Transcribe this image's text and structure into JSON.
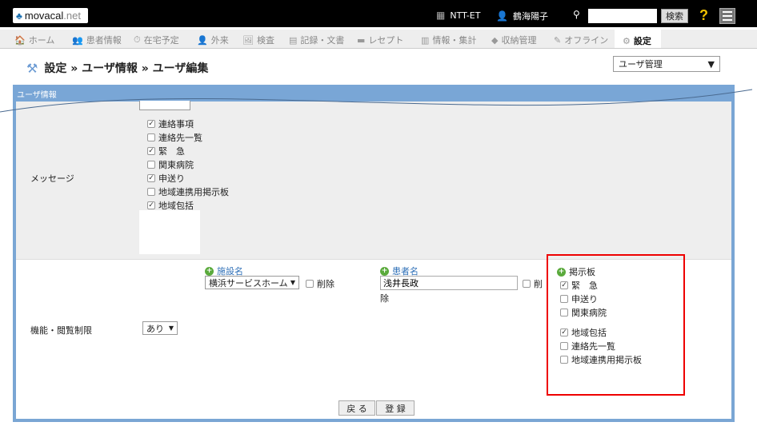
{
  "header": {
    "logo_mark": "♣",
    "logo_main": "movacal",
    "logo_net": ".net",
    "facility": "NTT-ET",
    "user": "鶴海陽子",
    "search_placeholder": "",
    "search_button": "検索",
    "help": "?"
  },
  "nav": [
    {
      "label": "ホーム",
      "icon": "🏠"
    },
    {
      "label": "患者情報",
      "icon": "👥"
    },
    {
      "label": "在宅予定",
      "icon": "⏱"
    },
    {
      "label": "外来",
      "icon": "👤"
    },
    {
      "label": "検査",
      "icon": "🖼"
    },
    {
      "label": "記録・文書",
      "icon": "▤"
    },
    {
      "label": "レセプト",
      "icon": "▬"
    },
    {
      "label": "情報・集計",
      "icon": "▥"
    },
    {
      "label": "収納管理",
      "icon": "◆"
    },
    {
      "label": "オフライン",
      "icon": "✎"
    },
    {
      "label": "設定",
      "icon": "⚙"
    }
  ],
  "breadcrumb": "設定 » ユーザ情報 » ユーザ編集",
  "top_select": {
    "value": "ユーザ管理"
  },
  "panel_title": "ユーザ情報",
  "message_section": {
    "label": "メッセージ",
    "items": [
      {
        "label": "連絡事項",
        "checked": true
      },
      {
        "label": "連絡先一覧",
        "checked": false
      },
      {
        "label": "緊　急",
        "checked": true
      },
      {
        "label": "関東病院",
        "checked": false
      },
      {
        "label": "申送り",
        "checked": true
      },
      {
        "label": "地域連携用掲示板",
        "checked": false
      },
      {
        "label": "地域包括",
        "checked": true
      }
    ]
  },
  "function_section": {
    "label": "機能・閲覧制限",
    "restrict_value": "あり",
    "facility_header": "施設名",
    "facility_value": "横浜サービスホーム",
    "delete_label": "削除",
    "patient_header": "患者名",
    "patient_value": "浅井長政",
    "patient_delete_1": "削",
    "patient_delete_2": "除",
    "board_header": "掲示板",
    "board_items": [
      {
        "label": "緊　急",
        "checked": true
      },
      {
        "label": "申送り",
        "checked": false
      },
      {
        "label": "関東病院",
        "checked": false
      },
      {
        "label": "地域包括",
        "checked": true
      },
      {
        "label": "連絡先一覧",
        "checked": false
      },
      {
        "label": "地域連携用掲示板",
        "checked": false
      }
    ]
  },
  "buttons": {
    "back": "戻 る",
    "register": "登 録"
  },
  "colors": {
    "accent": "#79a6d6",
    "highlight": "#e00000",
    "add": "#5aaa3c"
  }
}
